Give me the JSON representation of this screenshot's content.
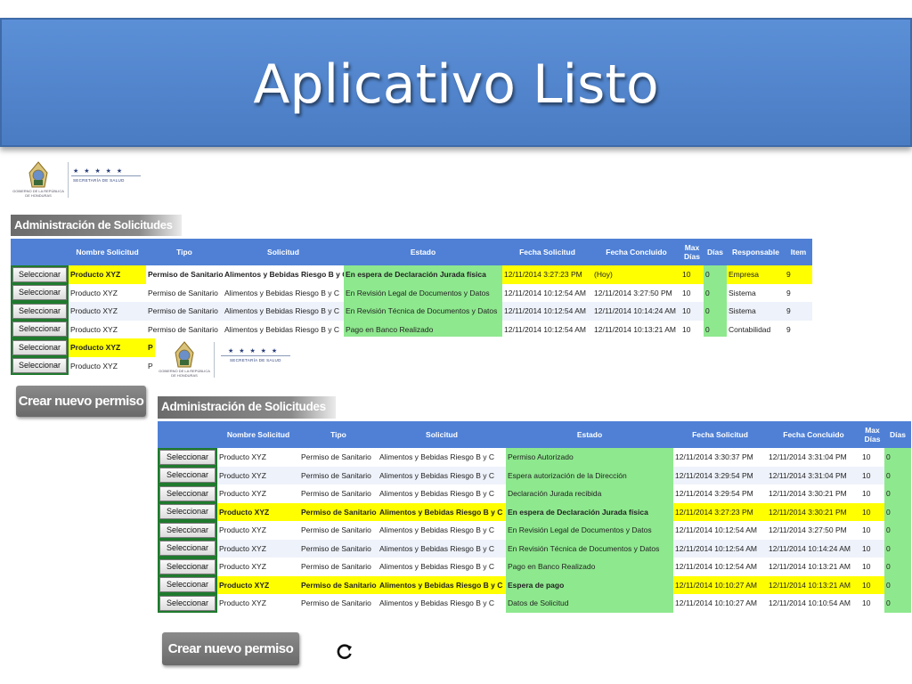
{
  "slide": {
    "title": "Aplicativo Listo"
  },
  "logo": {
    "seal_caption": "GOBIERNO DE LA REPÚBLICA DE HONDURAS",
    "stars": "★ ★ ★ ★ ★",
    "agency": "SECRETARÍA DE SALUD"
  },
  "panel1": {
    "header": "Administración de Solicitudes",
    "columns": [
      "",
      "Nombre Solicitud",
      "Tipo",
      "Solicitud",
      "Estado",
      "Fecha Solicitud",
      "Fecha Concluido",
      "Max Días",
      "Días",
      "Responsable",
      "Item"
    ],
    "button_label": "Seleccionar",
    "rows": [
      {
        "nombre": "Producto XYZ",
        "tipo": "Permiso de Sanitario",
        "solicitud": "Alimentos y Bebidas Riesgo B y C",
        "estado": "En espera de Declaración Jurada física",
        "fecha_solicitud": "12/11/2014 3:27:23 PM",
        "fecha_concluido": "(Hoy)",
        "max_dias": "10",
        "dias": "0",
        "responsable": "Empresa",
        "item": "9"
      },
      {
        "nombre": "Producto XYZ",
        "tipo": "Permiso de Sanitario",
        "solicitud": "Alimentos y Bebidas Riesgo B y C",
        "estado": "En Revisión Legal de Documentos y Datos",
        "fecha_solicitud": "12/11/2014 10:12:54 AM",
        "fecha_concluido": "12/11/2014 3:27:50 PM",
        "max_dias": "10",
        "dias": "0",
        "responsable": "Sistema",
        "item": "9"
      },
      {
        "nombre": "Producto XYZ",
        "tipo": "Permiso de Sanitario",
        "solicitud": "Alimentos y Bebidas Riesgo B y C",
        "estado": "En Revisión Técnica de Documentos y Datos",
        "fecha_solicitud": "12/11/2014 10:12:54 AM",
        "fecha_concluido": "12/11/2014 10:14:24 AM",
        "max_dias": "10",
        "dias": "0",
        "responsable": "Sistema",
        "item": "9"
      },
      {
        "nombre": "Producto XYZ",
        "tipo": "Permiso de Sanitario",
        "solicitud": "Alimentos y Bebidas Riesgo B y C",
        "estado": "Pago en Banco Realizado",
        "fecha_solicitud": "12/11/2014 10:12:54 AM",
        "fecha_concluido": "12/11/2014 10:13:21 AM",
        "max_dias": "10",
        "dias": "0",
        "responsable": "Contabilidad",
        "item": "9"
      },
      {
        "nombre": "Producto XYZ",
        "tipo": "P"
      },
      {
        "nombre": "Producto XYZ",
        "tipo": "P"
      }
    ],
    "create_label": "Crear nuevo permiso"
  },
  "panel2": {
    "header": "Administración de Solicitudes",
    "columns": [
      "",
      "Nombre Solicitud",
      "Tipo",
      "Solicitud",
      "Estado",
      "Fecha Solicitud",
      "Fecha Concluido",
      "Max Días",
      "Días"
    ],
    "button_label": "Seleccionar",
    "rows": [
      {
        "nombre": "Producto XYZ",
        "tipo": "Permiso de Sanitario",
        "solicitud": "Alimentos y Bebidas Riesgo B y C",
        "estado": "Permiso Autorizado",
        "fecha_solicitud": "12/11/2014 3:30:37 PM",
        "fecha_concluido": "12/11/2014 3:31:04 PM",
        "max_dias": "10",
        "dias": "0"
      },
      {
        "nombre": "Producto XYZ",
        "tipo": "Permiso de Sanitario",
        "solicitud": "Alimentos y Bebidas Riesgo B y C",
        "estado": "Espera autorización de la Dirección",
        "fecha_solicitud": "12/11/2014 3:29:54 PM",
        "fecha_concluido": "12/11/2014 3:31:04 PM",
        "max_dias": "10",
        "dias": "0"
      },
      {
        "nombre": "Producto XYZ",
        "tipo": "Permiso de Sanitario",
        "solicitud": "Alimentos y Bebidas Riesgo B y C",
        "estado": "Declaración Jurada recibida",
        "fecha_solicitud": "12/11/2014 3:29:54 PM",
        "fecha_concluido": "12/11/2014 3:30:21 PM",
        "max_dias": "10",
        "dias": "0"
      },
      {
        "nombre": "Producto XYZ",
        "tipo": "Permiso de Sanitario",
        "solicitud": "Alimentos y Bebidas Riesgo B y C",
        "estado": "En espera de Declaración Jurada física",
        "fecha_solicitud": "12/11/2014 3:27:23 PM",
        "fecha_concluido": "12/11/2014 3:30:21 PM",
        "max_dias": "10",
        "dias": "0"
      },
      {
        "nombre": "Producto XYZ",
        "tipo": "Permiso de Sanitario",
        "solicitud": "Alimentos y Bebidas Riesgo B y C",
        "estado": "En Revisión Legal de Documentos y Datos",
        "fecha_solicitud": "12/11/2014 10:12:54 AM",
        "fecha_concluido": "12/11/2014 3:27:50 PM",
        "max_dias": "10",
        "dias": "0"
      },
      {
        "nombre": "Producto XYZ",
        "tipo": "Permiso de Sanitario",
        "solicitud": "Alimentos y Bebidas Riesgo B y C",
        "estado": "En Revisión Técnica de Documentos y Datos",
        "fecha_solicitud": "12/11/2014 10:12:54 AM",
        "fecha_concluido": "12/11/2014 10:14:24 AM",
        "max_dias": "10",
        "dias": "0"
      },
      {
        "nombre": "Producto XYZ",
        "tipo": "Permiso de Sanitario",
        "solicitud": "Alimentos y Bebidas Riesgo B y C",
        "estado": "Pago en Banco Realizado",
        "fecha_solicitud": "12/11/2014 10:12:54 AM",
        "fecha_concluido": "12/11/2014 10:13:21 AM",
        "max_dias": "10",
        "dias": "0"
      },
      {
        "nombre": "Producto XYZ",
        "tipo": "Permiso de Sanitario",
        "solicitud": "Alimentos y Bebidas Riesgo B y C",
        "estado": "Espera de pago",
        "fecha_solicitud": "12/11/2014 10:10:27 AM",
        "fecha_concluido": "12/11/2014 10:13:21 AM",
        "max_dias": "10",
        "dias": "0"
      },
      {
        "nombre": "Producto XYZ",
        "tipo": "Permiso de Sanitario",
        "solicitud": "Alimentos y Bebidas Riesgo B y C",
        "estado": "Datos de Solicitud",
        "fecha_solicitud": "12/11/2014 10:10:27 AM",
        "fecha_concluido": "12/11/2014 10:10:54 AM",
        "max_dias": "10",
        "dias": "0"
      }
    ],
    "create_label": "Crear nuevo permiso"
  },
  "colors": {
    "header_blue": "#4f80d6",
    "highlight_yellow": "#ffff00",
    "status_green": "#8ee88e",
    "button_border_green": "#1f7a2e"
  },
  "icons": {
    "refresh": "refresh-icon"
  }
}
